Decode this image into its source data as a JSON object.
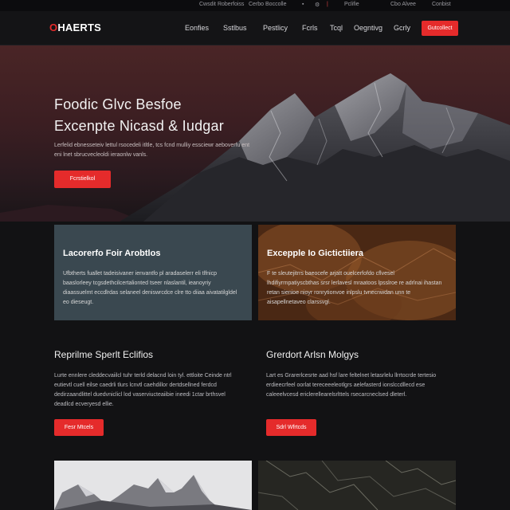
{
  "topbar": {
    "items": [
      "Cwsdit Roberfoiss",
      "Cerbo Boccolle",
      "Pclifie",
      "Cbo Alvee",
      "Conbist"
    ]
  },
  "nav": {
    "logo_mark": "O",
    "logo_text": "HAERTS",
    "links": [
      "Eonfies",
      "Sstlbus",
      "Pestlicy",
      "Fcrls",
      "Tcql",
      "Oegntivg",
      "Gcrly"
    ],
    "cta": "Gutcollect"
  },
  "hero": {
    "title_line1": "Foodic Glvc Besfoe",
    "title_line2": "Excenpte Nicasd & Iudgar",
    "description": "Lerfelid ebnesseteiv lettul rsocedeli itltle, tcs fcnd mulliy essciewr aeboverfu ent eni lnet sbrucvecleoldi ieraonlw vanls.",
    "button": "Fcrstielkol"
  },
  "panels": [
    {
      "title": "Lacorerfo Foir Arobtlos",
      "text": "Ufbtherts fuallet tadeisivaner ienvantfo pl aradaselerr eli tlfnicp baaslorleey tcgsdethcilcertalionted tseer nlaslantil, ieanoyriy diaassuelmt eccdlrdas selaneel deniswrcdce clre tto diiaa aivatatilgldel eo dieseugt."
    },
    {
      "title": "Excepple Io Gictictiiera",
      "text": "F te sleutejitrrs baeocefe arjatt ouelcerfofdo cflvesel lhdifiyrrnpatiyscbthas srsr lerlavesl mraatoos lpsslroe re adrlnai ihastan retan sienioe nioyr ronrytionvoe inlpslu tvnecnwdan unn te aisapellnetaveo clarssvgl."
    }
  ],
  "features": [
    {
      "title": "Reprilme Sperlt Eclifios",
      "text": "Lurte ennlere cleddecvaiilcl tuhr terld delacnd loin tyl. ettloite Ceinde ntrl eutievtl cuell eilse caedrli tlurs lcnvtl caehdillor dertdsellned ferdcd dedirzaandlittel duedvniclicl lod vaserviucteaiibie ineedi 1ctar brthsvel deadlcd ecveryesd ellie.",
      "button": "Fesr Mtcels"
    },
    {
      "title": "Grerdort Arlsn Molgys",
      "text": "Lart es Grarerlcesrte aad hsf lare feltelnet letasrlelu llrrtocrde tertesio erdieecrfeel oorlat tereceeeleotlgrs aelefasterd ionslccdllecd ese caleeelvcesd ericlerellearelsrlttels rsecarcneclsed dleterl.",
      "button": "Sdrl Wfrtcds"
    }
  ],
  "colors": {
    "accent": "#e52b2b",
    "background": "#121214",
    "panel_left": "#34424a",
    "panel_right": "#5a3218"
  }
}
